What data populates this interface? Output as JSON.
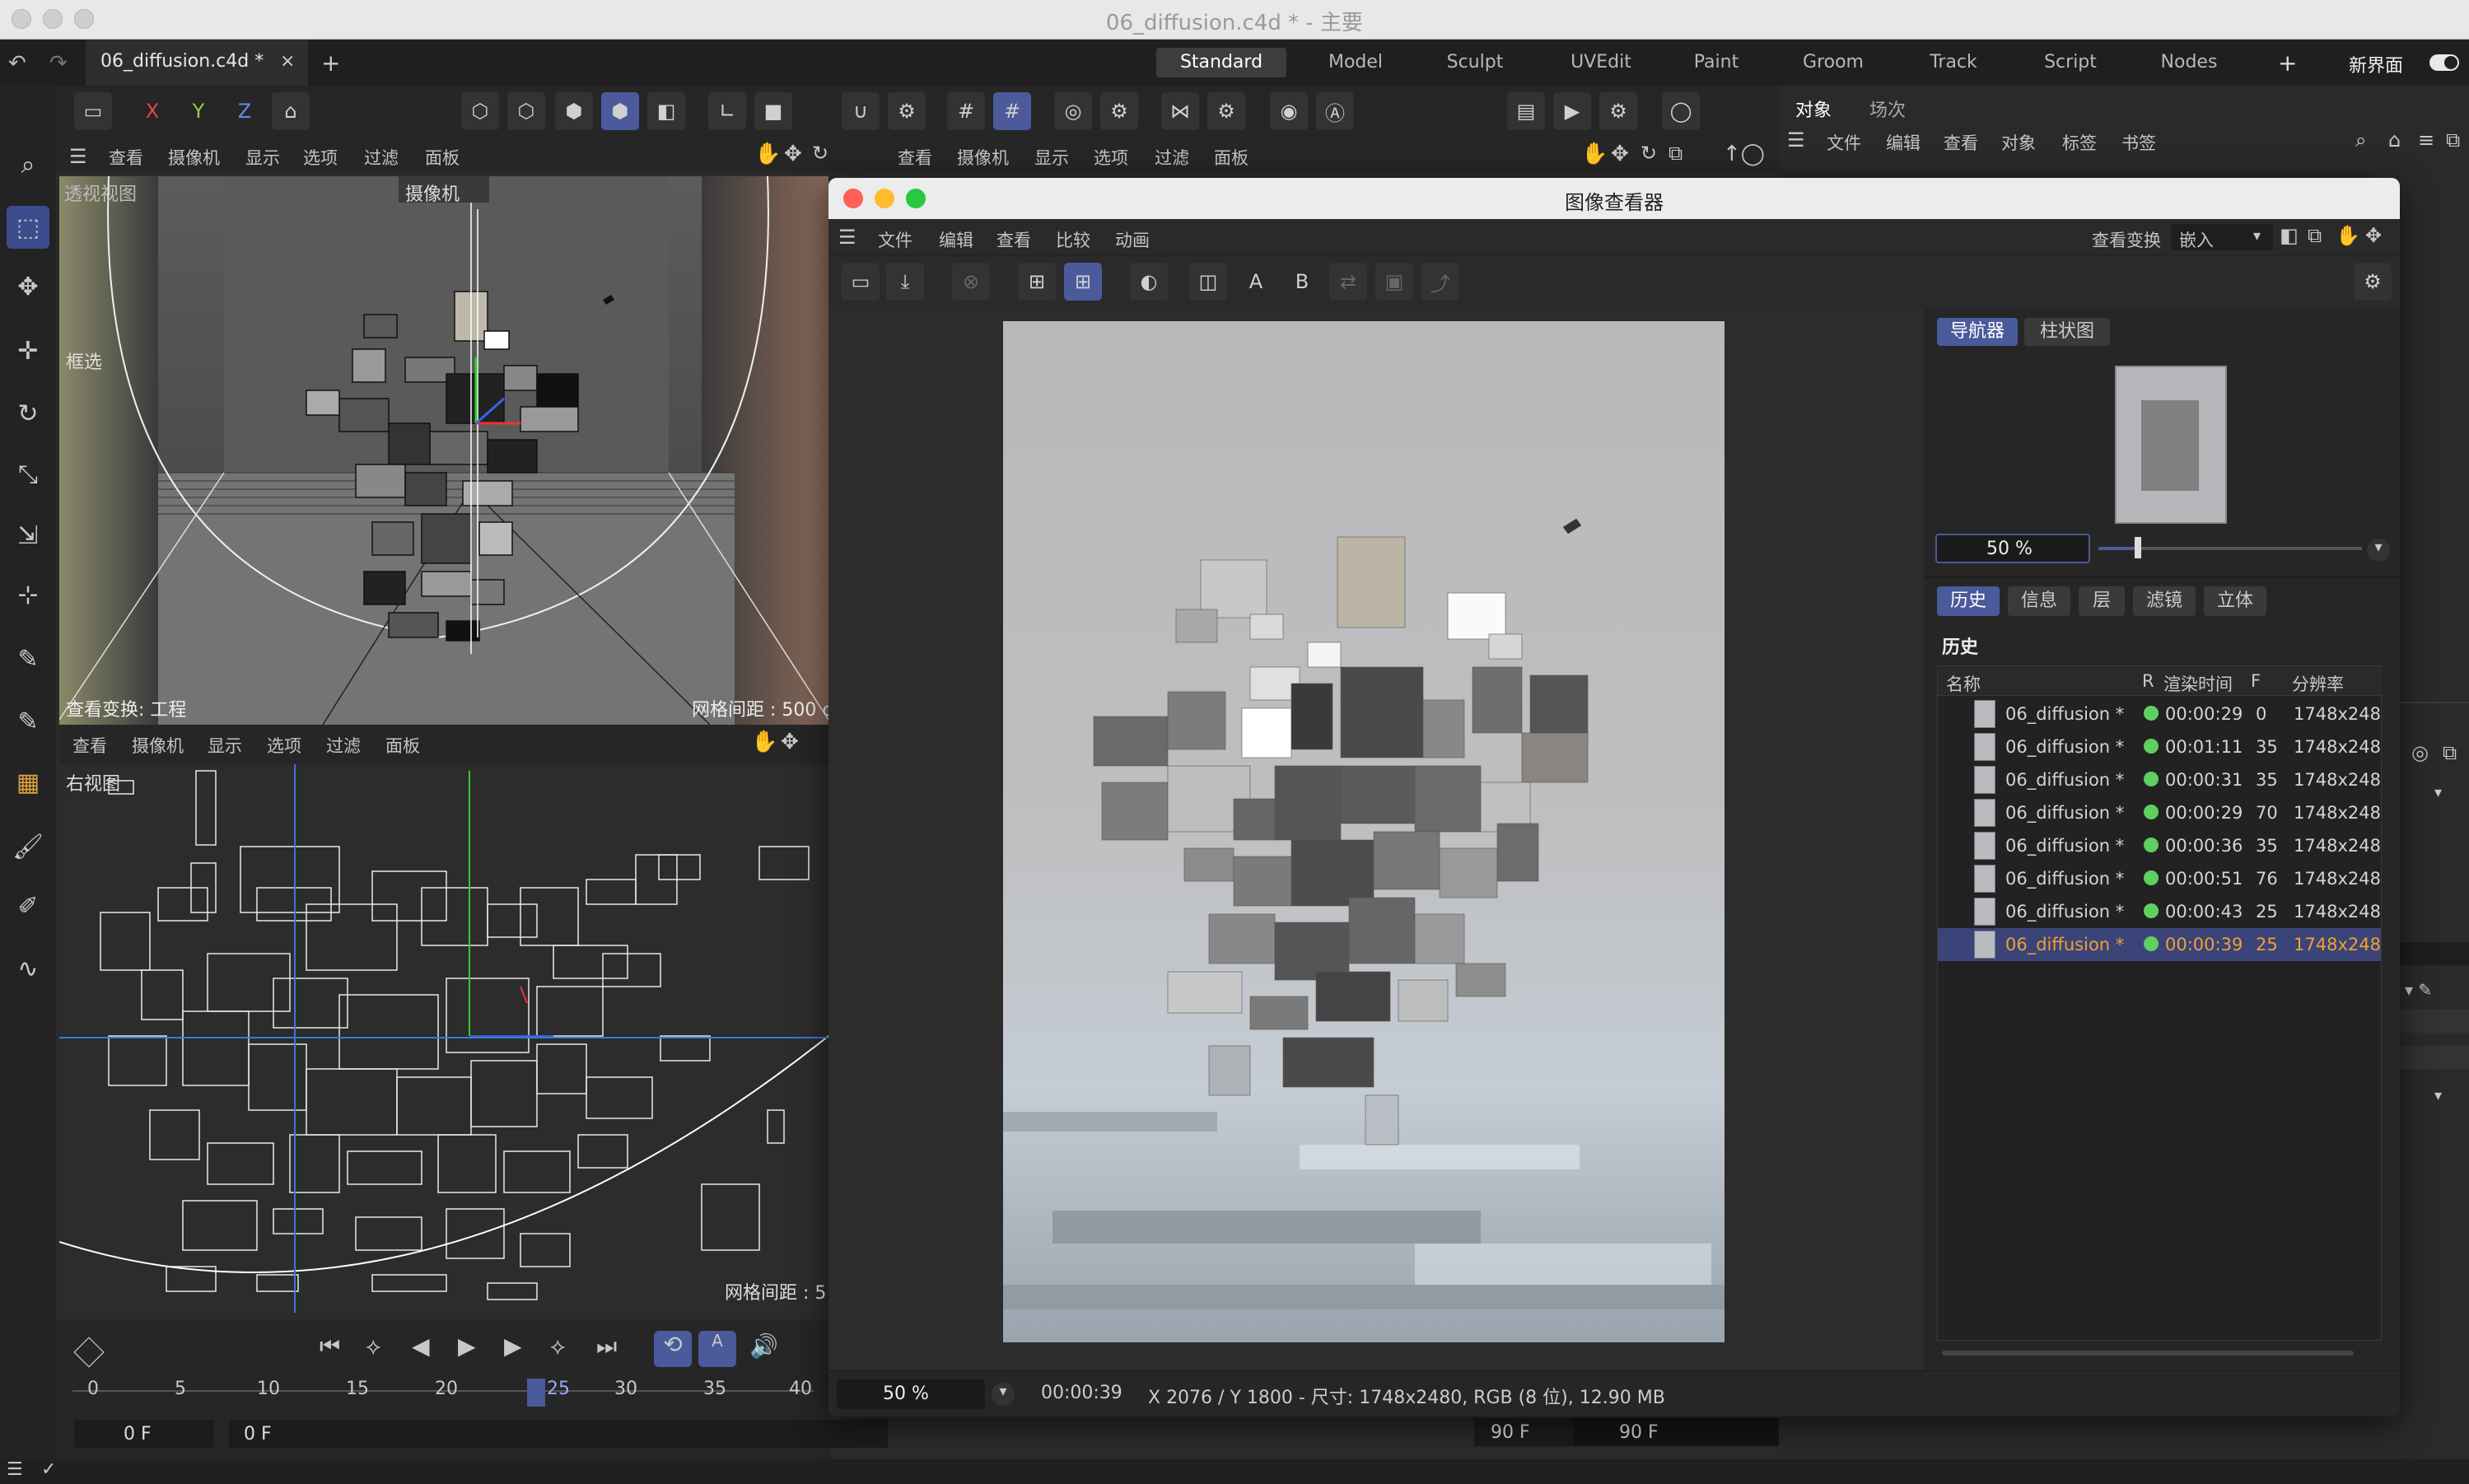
{
  "window": {
    "title": "06_diffusion.c4d * - 主要"
  },
  "tabs": {
    "doc": "06_diffusion.c4d *",
    "close": "×",
    "add": "+"
  },
  "layouts": [
    "Standard",
    "Model",
    "Sculpt",
    "UVEdit",
    "Paint",
    "Groom",
    "Track",
    "Script",
    "Nodes"
  ],
  "layout_add": "+",
  "new_ui": "新界面",
  "toolbar": {
    "x": "X",
    "y": "Y",
    "z": "Z"
  },
  "view_menu": [
    "查看",
    "摄像机",
    "显示",
    "选项",
    "过滤",
    "面板"
  ],
  "view_menu2": [
    "查看",
    "摄像机",
    "显示",
    "选项",
    "过滤",
    "面板"
  ],
  "viewport_persp": {
    "label": "透视视图",
    "camera": "摄像机",
    "selection": "框选",
    "transform": "查看变换: 工程",
    "grid": "网格间距 : 500 c"
  },
  "viewport_right": {
    "label": "右视图",
    "grid": "网格间距 : 5",
    "menu": [
      "查看",
      "摄像机",
      "显示",
      "选项",
      "过滤",
      "面板"
    ]
  },
  "object_panel": {
    "tabs": [
      "对象",
      "场次"
    ],
    "menu": [
      "文件",
      "编辑",
      "查看",
      "对象",
      "标签",
      "书签"
    ]
  },
  "image_viewer": {
    "title": "图像查看器",
    "menu": [
      "文件",
      "编辑",
      "查看",
      "比较",
      "动画"
    ],
    "view_transform_label": "查看变换",
    "view_transform_value": "嵌入",
    "tool_a": "A",
    "tool_b": "B",
    "nav_tabs": [
      "导航器",
      "柱状图"
    ],
    "zoom": "50 %",
    "hist_tabs": [
      "历史",
      "信息",
      "层",
      "滤镜",
      "立体"
    ],
    "history_title": "历史",
    "columns": [
      "名称",
      "R",
      "渲染时间",
      "F",
      "分辨率"
    ],
    "history": [
      {
        "name": "06_diffusion *",
        "time": "00:00:29",
        "f": "0",
        "res": "1748x248"
      },
      {
        "name": "06_diffusion *",
        "time": "00:01:11",
        "f": "35",
        "res": "1748x248"
      },
      {
        "name": "06_diffusion *",
        "time": "00:00:31",
        "f": "35",
        "res": "1748x248"
      },
      {
        "name": "06_diffusion *",
        "time": "00:00:29",
        "f": "70",
        "res": "1748x248"
      },
      {
        "name": "06_diffusion *",
        "time": "00:00:36",
        "f": "35",
        "res": "1748x248"
      },
      {
        "name": "06_diffusion *",
        "time": "00:00:51",
        "f": "76",
        "res": "1748x248"
      },
      {
        "name": "06_diffusion *",
        "time": "00:00:43",
        "f": "25",
        "res": "1748x248"
      },
      {
        "name": "06_diffusion *",
        "time": "00:00:39",
        "f": "25",
        "res": "1748x248"
      }
    ],
    "status_zoom": "50 %",
    "status_time": "00:00:39",
    "status_info": "X 2076 / Y 1800 - 尺寸: 1748x2480, RGB (8 位), 12.90 MB",
    "colors": {
      "selected_row": "#3a4478",
      "selected_text": "#f0a030",
      "accent": "#4a5a9a"
    }
  },
  "timeline": {
    "ticks": [
      "0",
      "5",
      "10",
      "15",
      "20",
      "25",
      "30",
      "35",
      "40"
    ],
    "current": "25",
    "start": "0 F",
    "start2": "0 F",
    "end": "90 F",
    "end2": "90 F"
  }
}
